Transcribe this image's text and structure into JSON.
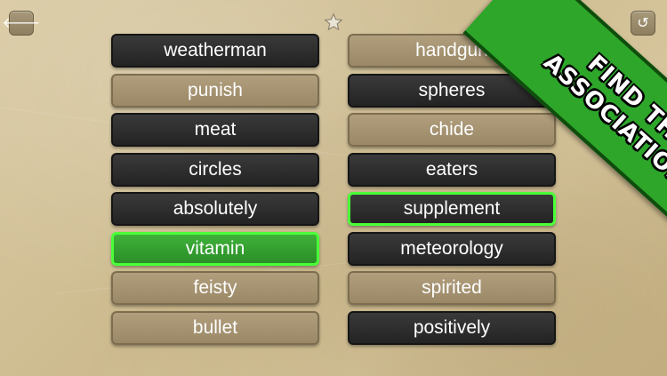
{
  "toolbar": {
    "back_icon": "arrow-left-icon",
    "back_glyph": "🡐",
    "undo_icon": "undo-icon",
    "undo_glyph": "↺"
  },
  "rating_icon": "star-icon",
  "banner": {
    "line1": "FIND THE",
    "line2": "ASSOCIATION!",
    "color": "#2da62a"
  },
  "colors": {
    "dark_tile": "#2b2b2b",
    "tan_tile": "#a69474",
    "selected_green": "#2e9a2b",
    "highlight_border": "#4aff38"
  },
  "left_column": [
    {
      "word": "weatherman",
      "style": "dark"
    },
    {
      "word": "punish",
      "style": "tan"
    },
    {
      "word": "meat",
      "style": "dark"
    },
    {
      "word": "circles",
      "style": "dark"
    },
    {
      "word": "absolutely",
      "style": "dark"
    },
    {
      "word": "vitamin",
      "style": "green"
    },
    {
      "word": "feisty",
      "style": "tan"
    },
    {
      "word": "bullet",
      "style": "tan"
    }
  ],
  "right_column": [
    {
      "word": "handgun",
      "style": "tan"
    },
    {
      "word": "spheres",
      "style": "dark"
    },
    {
      "word": "chide",
      "style": "tan"
    },
    {
      "word": "eaters",
      "style": "dark"
    },
    {
      "word": "supplement",
      "style": "dark-selected"
    },
    {
      "word": "meteorology",
      "style": "dark"
    },
    {
      "word": "spirited",
      "style": "tan"
    },
    {
      "word": "positively",
      "style": "dark"
    }
  ]
}
